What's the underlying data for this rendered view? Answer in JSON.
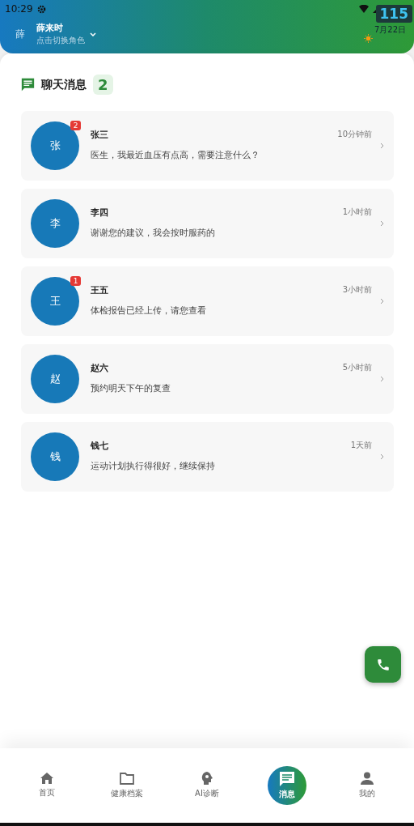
{
  "status_bar": {
    "time": "10:29",
    "overlay_count": "115"
  },
  "header": {
    "avatar": "薛",
    "name": "薛来时",
    "subtitle": "点击切换角色",
    "date": "7月22日"
  },
  "chat_section": {
    "title": "聊天消息",
    "count": "2"
  },
  "chats": [
    {
      "avatar": "张",
      "name": "张三",
      "time": "10分钟前",
      "message": "医生，我最近血压有点高，需要注意什么？",
      "unread": "2"
    },
    {
      "avatar": "李",
      "name": "李四",
      "time": "1小时前",
      "message": "谢谢您的建议，我会按时服药的"
    },
    {
      "avatar": "王",
      "name": "王五",
      "time": "3小时前",
      "message": "体检报告已经上传，请您查看",
      "unread": "1"
    },
    {
      "avatar": "赵",
      "name": "赵六",
      "time": "5小时前",
      "message": "预约明天下午的复查"
    },
    {
      "avatar": "钱",
      "name": "钱七",
      "time": "1天前",
      "message": "运动计划执行得很好，继续保持"
    }
  ],
  "bottom_nav": [
    {
      "kind": "home",
      "label": "首页",
      "selected": false
    },
    {
      "kind": "folder",
      "label": "健康档案",
      "selected": false
    },
    {
      "kind": "brain",
      "label": "AI诊断",
      "selected": false
    },
    {
      "kind": "chat",
      "label": "消息",
      "selected": true
    },
    {
      "kind": "person",
      "label": "我的",
      "selected": false
    }
  ]
}
